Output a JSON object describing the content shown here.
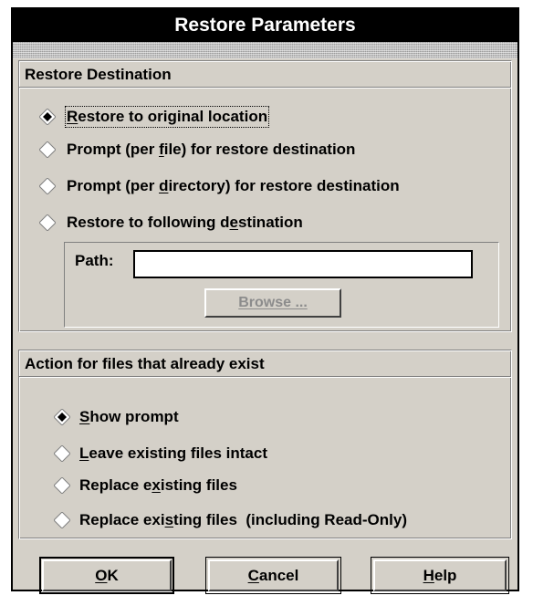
{
  "dialog": {
    "title": "Restore Parameters"
  },
  "destination": {
    "title": "Restore Destination",
    "options": [
      {
        "pre": "",
        "u": "R",
        "post": "estore to original location",
        "selected": true
      },
      {
        "pre": "Prompt (per ",
        "u": "f",
        "post": "ile) for restore destination",
        "selected": false
      },
      {
        "pre": "Prompt (per ",
        "u": "d",
        "post": "irectory) for restore destination",
        "selected": false
      },
      {
        "pre": "Restore to following d",
        "u": "e",
        "post": "stination",
        "selected": false
      }
    ],
    "path_label": "Path:",
    "path_value": "",
    "browse_label": "Browse ..."
  },
  "existing": {
    "title": "Action for files that already exist",
    "options": [
      {
        "pre": "",
        "u": "S",
        "post": "how prompt",
        "selected": true
      },
      {
        "pre": "",
        "u": "L",
        "post": "eave existing files intact",
        "selected": false
      },
      {
        "pre": "Replace e",
        "u": "x",
        "post": "isting files",
        "selected": false
      },
      {
        "pre": "Replace exi",
        "u": "s",
        "post": "ting files  (including Read-Only)",
        "selected": false
      }
    ]
  },
  "buttons": {
    "ok": {
      "pre": "",
      "u": "O",
      "post": "K"
    },
    "cancel": {
      "pre": "",
      "u": "C",
      "post": "ancel"
    },
    "help": {
      "pre": "",
      "u": "H",
      "post": "elp"
    }
  }
}
